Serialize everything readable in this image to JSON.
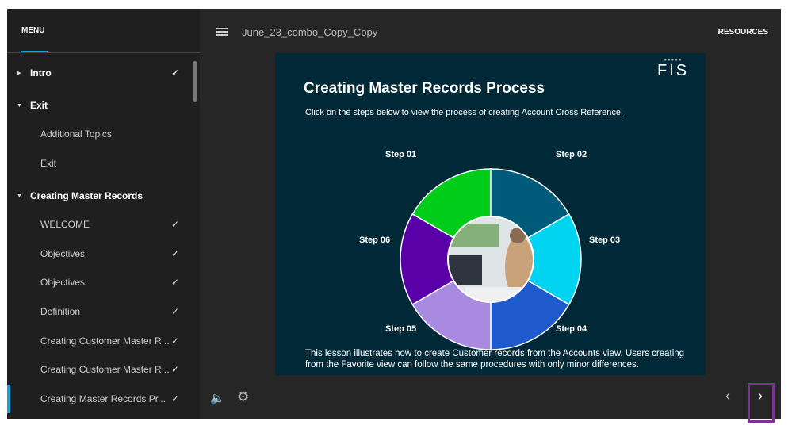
{
  "sidebar": {
    "tab": "MENU",
    "items": [
      {
        "label": "Intro",
        "type": "section",
        "expanded": false,
        "check": "✓"
      },
      {
        "label": "Exit",
        "type": "section",
        "expanded": true,
        "check": ""
      },
      {
        "label": "Additional Topics",
        "type": "page",
        "check": ""
      },
      {
        "label": "Exit",
        "type": "page",
        "check": ""
      },
      {
        "label": "Creating Master Records",
        "type": "section",
        "expanded": true,
        "check": ""
      },
      {
        "label": "WELCOME",
        "type": "page",
        "check": "✓"
      },
      {
        "label": "Objectives",
        "type": "page",
        "check": "✓"
      },
      {
        "label": "Objectives",
        "type": "page",
        "check": "✓"
      },
      {
        "label": "Definition",
        "type": "page",
        "check": "✓"
      },
      {
        "label": "Creating Customer Master R...",
        "type": "page",
        "check": "✓"
      },
      {
        "label": "Creating Customer Master R...",
        "type": "page",
        "check": "✓"
      },
      {
        "label": "Creating Master Records Pr...",
        "type": "page",
        "check": "✓",
        "active": true
      }
    ]
  },
  "header": {
    "title": "June_23_combo_Copy_Copy",
    "resources": "RESOURCES"
  },
  "slide": {
    "title": "Creating Master Records Process",
    "subtitle": "Click on the steps below to view the process of creating Account Cross Reference.",
    "footer": "This lesson illustrates how to create Customer records from the Accounts view. Users creating from the Favorite view can follow the same procedures with only minor differences.",
    "logo": "FIS",
    "steps": [
      {
        "label": "Step 01",
        "color": "#00cc1a"
      },
      {
        "label": "Step 02",
        "color": "#005a7a"
      },
      {
        "label": "Step 03",
        "color": "#00d4f0"
      },
      {
        "label": "Step 04",
        "color": "#1f5acc"
      },
      {
        "label": "Step 05",
        "color": "#a88ae0"
      },
      {
        "label": "Step 06",
        "color": "#5a00a8"
      }
    ]
  },
  "controls": {
    "prev": "‹",
    "next": "›",
    "audio": "🔈",
    "settings": "⚙"
  }
}
